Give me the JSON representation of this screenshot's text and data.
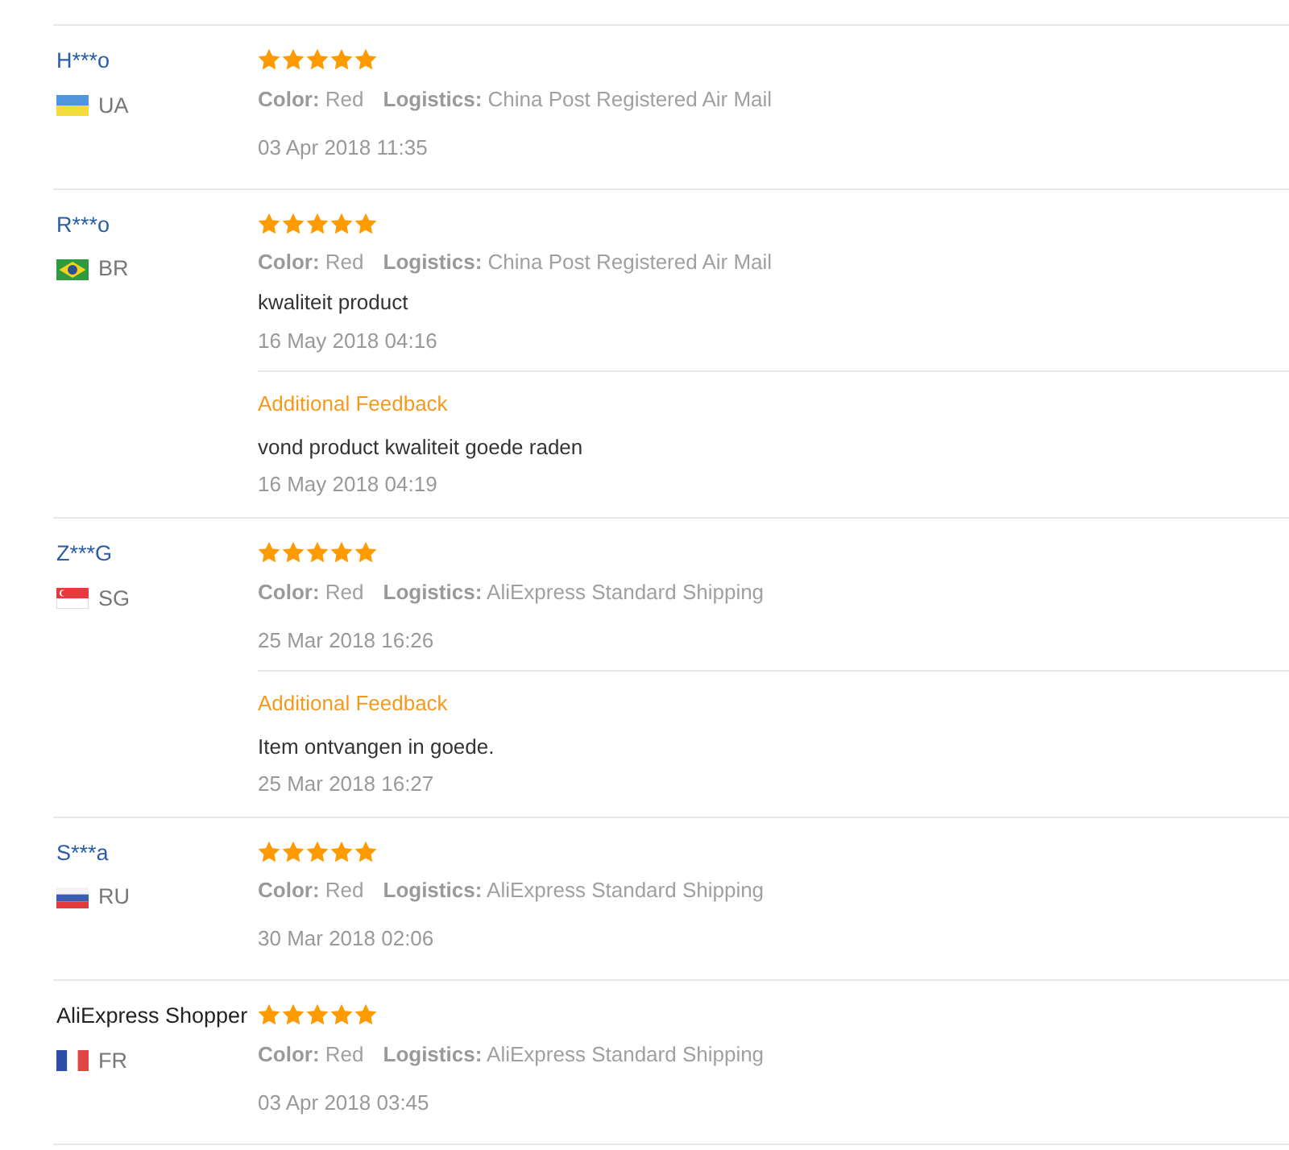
{
  "reviews": [
    {
      "reviewer": {
        "name": "H***o",
        "kind": "masked"
      },
      "country": "UA",
      "stars": 5,
      "attributes": [
        {
          "label": "Color:",
          "value": "Red"
        },
        {
          "label": "Logistics:",
          "value": "China Post Registered Air Mail"
        }
      ],
      "date": "03 Apr 2018 11:35"
    },
    {
      "reviewer": {
        "name": "R***o",
        "kind": "masked"
      },
      "country": "BR",
      "stars": 5,
      "attributes": [
        {
          "label": "Color:",
          "value": "Red"
        },
        {
          "label": "Logistics:",
          "value": "China Post Registered Air Mail"
        }
      ],
      "comment": "kwaliteit product",
      "date": "16 May 2018 04:16",
      "additional_feedback": {
        "heading": "Additional Feedback",
        "comment": "vond product kwaliteit goede raden",
        "date": "16 May 2018 04:19"
      }
    },
    {
      "reviewer": {
        "name": "Z***G",
        "kind": "masked"
      },
      "country": "SG",
      "stars": 5,
      "attributes": [
        {
          "label": "Color:",
          "value": "Red"
        },
        {
          "label": "Logistics:",
          "value": "AliExpress Standard Shipping"
        }
      ],
      "date": "25 Mar 2018 16:26",
      "additional_feedback": {
        "heading": "Additional Feedback",
        "comment": "Item ontvangen in goede.",
        "date": "25 Mar 2018 16:27"
      }
    },
    {
      "reviewer": {
        "name": "S***a",
        "kind": "masked"
      },
      "country": "RU",
      "stars": 5,
      "attributes": [
        {
          "label": "Color:",
          "value": "Red"
        },
        {
          "label": "Logistics:",
          "value": "AliExpress Standard Shipping"
        }
      ],
      "date": "30 Mar 2018 02:06"
    },
    {
      "reviewer": {
        "name": "AliExpress Shopper",
        "kind": "anonymous"
      },
      "country": "FR",
      "stars": 5,
      "attributes": [
        {
          "label": "Color:",
          "value": "Red"
        },
        {
          "label": "Logistics:",
          "value": "AliExpress Standard Shipping"
        }
      ],
      "date": "03 Apr 2018 03:45"
    }
  ]
}
